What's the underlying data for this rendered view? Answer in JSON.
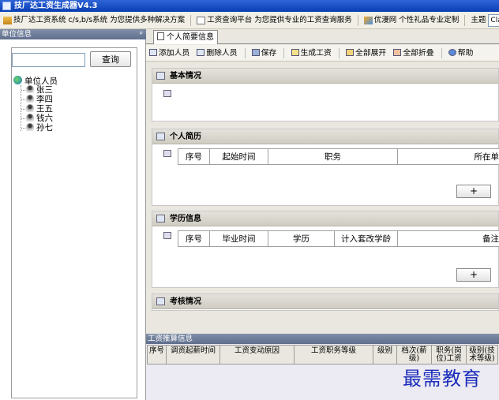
{
  "app": {
    "title": "技厂达工资生成器V4.3"
  },
  "linkbar": {
    "items": [
      "技厂达工资系统 c/s,b/s系统 为您提供多种解决方案",
      "工资查询平台 为您提供专业的工资查询服务",
      "优漫网 个性礼品专业定制"
    ],
    "theme_label": "主题",
    "theme_value": "Clas"
  },
  "left_panel": {
    "title": "单位信息",
    "pin": "ᵖ",
    "search_value": "",
    "search_button": "查询",
    "tree": {
      "root": "单位人员",
      "children": [
        "张三",
        "李四",
        "王五",
        "钱六",
        "孙七"
      ]
    }
  },
  "tab": {
    "label": "个人简要信息"
  },
  "toolbar": {
    "add": "添加人员",
    "delete": "删除人员",
    "save": "保存",
    "generate": "生成工资",
    "expand": "全部展开",
    "collapse": "全部折叠",
    "help": "帮助"
  },
  "sections": {
    "basic": {
      "title": "基本情况"
    },
    "resume": {
      "title": "个人简历",
      "columns": [
        "序号",
        "起始时间",
        "职务",
        "所在单"
      ],
      "add_button": "+"
    },
    "education": {
      "title": "学历信息",
      "columns": [
        "序号",
        "毕业时间",
        "学历",
        "计入套改学龄",
        "备注"
      ],
      "add_button": "+"
    },
    "assessment": {
      "title": "考核情况"
    }
  },
  "bottom_panel": {
    "title": "工资推算信息",
    "columns": [
      "序号",
      "调资起薪时间",
      "工资变动原因",
      "工资职务等级",
      "级别",
      "档次(薪级)",
      "职务(岗位)工资",
      "级别(技术等级)"
    ]
  },
  "watermark": "最需教育"
}
